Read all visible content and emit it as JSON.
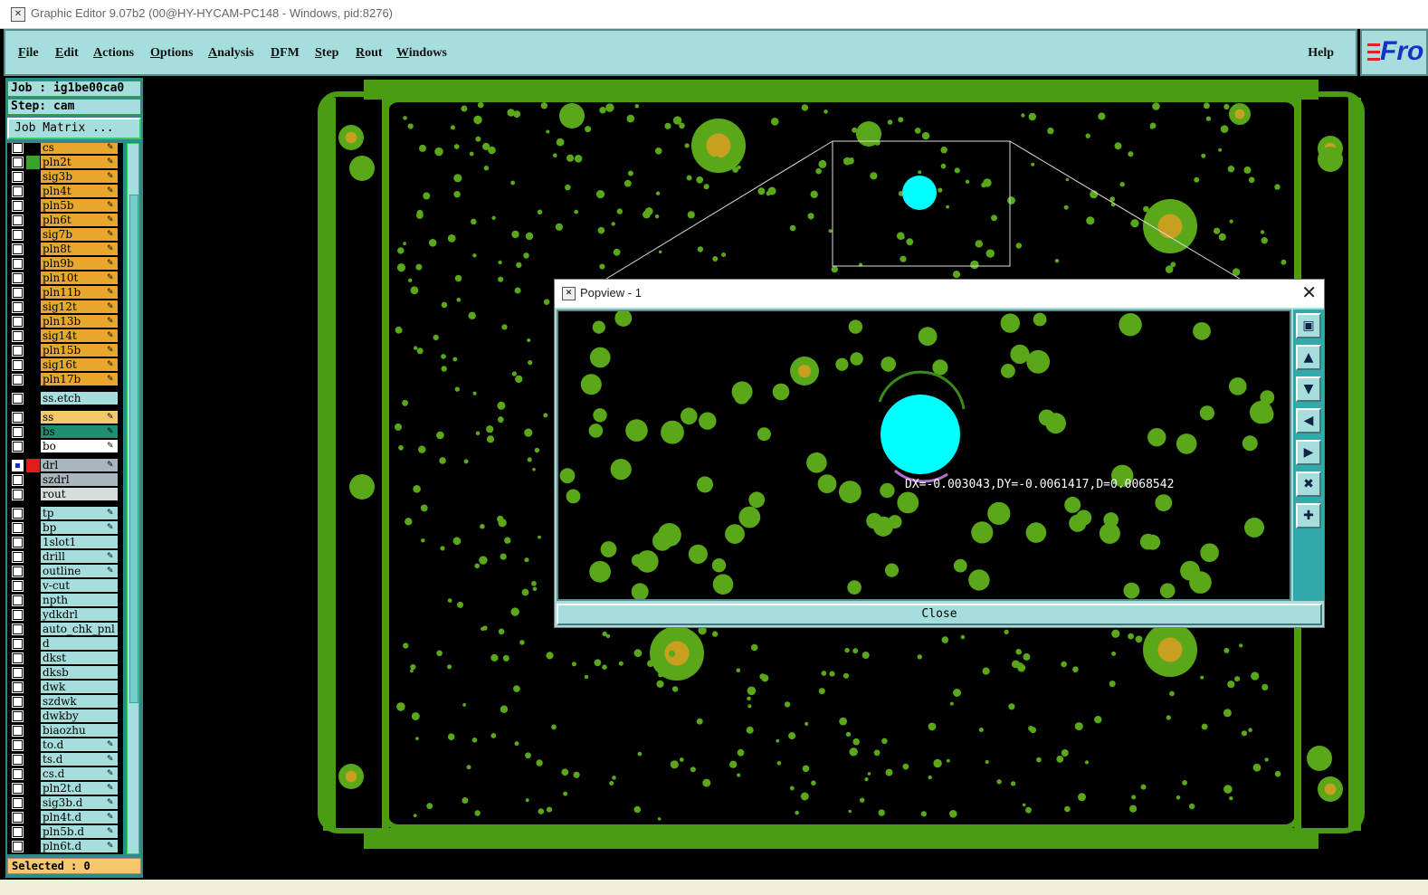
{
  "window": {
    "title": "Graphic Editor 9.07b2 (00@HY-HYCAM-PC148 - Windows, pid:8276)"
  },
  "menu": {
    "items": [
      "File",
      "Edit",
      "Actions",
      "Options",
      "Analysis",
      "DFM",
      "Step",
      "Rout",
      "Windows"
    ],
    "help": "Help",
    "logo": "Fro"
  },
  "panel": {
    "job": "Job : ig1be00ca0",
    "step": "Step: cam",
    "job_matrix": "Job Matrix ...",
    "selected": "Selected : 0"
  },
  "layers": [
    {
      "name": "cs",
      "color": "#e8a72a",
      "edit": true,
      "swatch": ""
    },
    {
      "name": "pln2t",
      "color": "#e8a72a",
      "edit": true,
      "swatch": "#3aa32a"
    },
    {
      "name": "sig3b",
      "color": "#e8a72a",
      "edit": true,
      "swatch": ""
    },
    {
      "name": "pln4t",
      "color": "#e8a72a",
      "edit": true,
      "swatch": ""
    },
    {
      "name": "pln5b",
      "color": "#e8a72a",
      "edit": true,
      "swatch": ""
    },
    {
      "name": "pln6t",
      "color": "#e8a72a",
      "edit": true,
      "swatch": ""
    },
    {
      "name": "sig7b",
      "color": "#e8a72a",
      "edit": true,
      "swatch": ""
    },
    {
      "name": "pln8t",
      "color": "#e8a72a",
      "edit": true,
      "swatch": ""
    },
    {
      "name": "pln9b",
      "color": "#e8a72a",
      "edit": true,
      "swatch": ""
    },
    {
      "name": "pln10t",
      "color": "#e8a72a",
      "edit": true,
      "swatch": ""
    },
    {
      "name": "pln11b",
      "color": "#e8a72a",
      "edit": true,
      "swatch": ""
    },
    {
      "name": "sig12t",
      "color": "#e8a72a",
      "edit": true,
      "swatch": ""
    },
    {
      "name": "pln13b",
      "color": "#e8a72a",
      "edit": true,
      "swatch": ""
    },
    {
      "name": "sig14t",
      "color": "#e8a72a",
      "edit": true,
      "swatch": ""
    },
    {
      "name": "pln15b",
      "color": "#e8a72a",
      "edit": true,
      "swatch": ""
    },
    {
      "name": "sig16t",
      "color": "#e8a72a",
      "edit": true,
      "swatch": ""
    },
    {
      "name": "pln17b",
      "color": "#e8a72a",
      "edit": true,
      "swatch": ""
    },
    {
      "name": "ss.etch",
      "color": "#a6dede",
      "edit": false,
      "swatch": "",
      "gap": true
    },
    {
      "name": "ss",
      "color": "#f5c86b",
      "edit": true,
      "swatch": "",
      "gap": true
    },
    {
      "name": "bs",
      "color": "#1f8f6f",
      "edit": true,
      "swatch": ""
    },
    {
      "name": "bo",
      "color": "#ffffff",
      "edit": true,
      "swatch": ""
    },
    {
      "name": "drl",
      "color": "#a9b6bd",
      "edit": true,
      "swatch": "#e51b1b",
      "gap": true,
      "checked": true
    },
    {
      "name": "szdrl",
      "color": "#a9b6bd",
      "edit": false,
      "swatch": ""
    },
    {
      "name": "rout",
      "color": "#d7dcdf",
      "edit": false,
      "swatch": ""
    },
    {
      "name": "tp",
      "color": "#a6dede",
      "edit": true,
      "swatch": "",
      "gap": true
    },
    {
      "name": "bp",
      "color": "#a6dede",
      "edit": true,
      "swatch": ""
    },
    {
      "name": "1slot1",
      "color": "#a6dede",
      "edit": false,
      "swatch": ""
    },
    {
      "name": "drill",
      "color": "#a6dede",
      "edit": true,
      "swatch": ""
    },
    {
      "name": "outline",
      "color": "#a6dede",
      "edit": true,
      "swatch": ""
    },
    {
      "name": "v-cut",
      "color": "#a6dede",
      "edit": false,
      "swatch": ""
    },
    {
      "name": "npth",
      "color": "#a6dede",
      "edit": false,
      "swatch": ""
    },
    {
      "name": "ydkdrl",
      "color": "#a6dede",
      "edit": false,
      "swatch": ""
    },
    {
      "name": "auto_chk_pnl",
      "color": "#a6dede",
      "edit": false,
      "swatch": ""
    },
    {
      "name": "d",
      "color": "#a6dede",
      "edit": false,
      "swatch": ""
    },
    {
      "name": "dkst",
      "color": "#a6dede",
      "edit": false,
      "swatch": ""
    },
    {
      "name": "dksb",
      "color": "#a6dede",
      "edit": false,
      "swatch": ""
    },
    {
      "name": "dwk",
      "color": "#a6dede",
      "edit": false,
      "swatch": ""
    },
    {
      "name": "szdwk",
      "color": "#a6dede",
      "edit": false,
      "swatch": ""
    },
    {
      "name": "dwkby",
      "color": "#a6dede",
      "edit": false,
      "swatch": ""
    },
    {
      "name": "biaozhu",
      "color": "#a6dede",
      "edit": false,
      "swatch": ""
    },
    {
      "name": "to.d",
      "color": "#a6dede",
      "edit": true,
      "swatch": ""
    },
    {
      "name": "ts.d",
      "color": "#a6dede",
      "edit": true,
      "swatch": ""
    },
    {
      "name": "cs.d",
      "color": "#a6dede",
      "edit": true,
      "swatch": ""
    },
    {
      "name": "pln2t.d",
      "color": "#a6dede",
      "edit": true,
      "swatch": ""
    },
    {
      "name": "sig3b.d",
      "color": "#a6dede",
      "edit": true,
      "swatch": ""
    },
    {
      "name": "pln4t.d",
      "color": "#a6dede",
      "edit": true,
      "swatch": ""
    },
    {
      "name": "pln5b.d",
      "color": "#a6dede",
      "edit": true,
      "swatch": ""
    },
    {
      "name": "pln6t.d",
      "color": "#a6dede",
      "edit": true,
      "swatch": ""
    }
  ],
  "popview": {
    "title": "Popview - 1",
    "close_label": "Close",
    "measurement": "DX=-0.003043,DY=-0.0061417,D=0.0068542",
    "tools": [
      "zoom-fit-icon",
      "zoom-in-icon",
      "zoom-out-icon",
      "pan-left-icon",
      "pan-right-icon",
      "zoom-full-icon",
      "zoom-center-icon"
    ]
  },
  "colors": {
    "board": "#4a9c12",
    "pad": "#5aa81a",
    "drill_hole": "#c8a020",
    "highlight": "#00ffff",
    "ui_teal": "#a6dede"
  }
}
